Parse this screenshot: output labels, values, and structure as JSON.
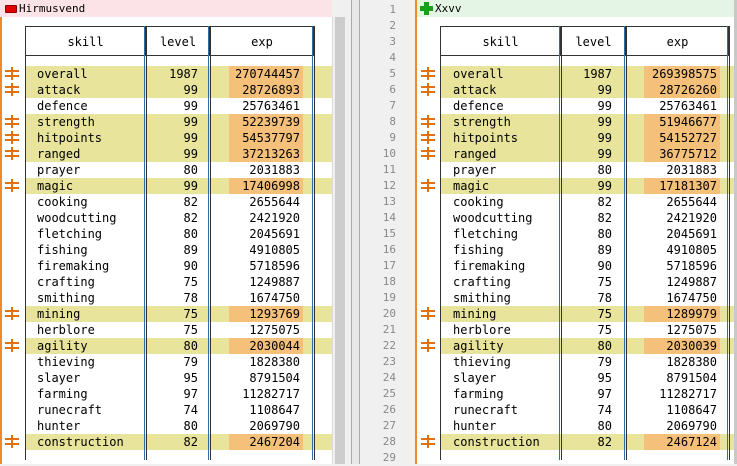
{
  "left_title": "Hirmusvend",
  "right_title": "Xxvv",
  "headers": {
    "skill": "skill",
    "level": "level",
    "exp": "exp"
  },
  "line_numbers": [
    "1",
    "2",
    "3",
    "4",
    "5",
    "6",
    "7",
    "8",
    "9",
    "10",
    "11",
    "12",
    "13",
    "14",
    "15",
    "16",
    "17",
    "18",
    "19",
    "20",
    "21",
    "22",
    "23",
    "24",
    "25",
    "26",
    "27",
    "28",
    "29"
  ],
  "left": [
    {
      "skill": "overall",
      "level": "1987",
      "exp": "270744457",
      "changed": true
    },
    {
      "skill": "attack",
      "level": "99",
      "exp": "28726893",
      "changed": true
    },
    {
      "skill": "defence",
      "level": "99",
      "exp": "25763461",
      "changed": false
    },
    {
      "skill": "strength",
      "level": "99",
      "exp": "52239739",
      "changed": true
    },
    {
      "skill": "hitpoints",
      "level": "99",
      "exp": "54537797",
      "changed": true
    },
    {
      "skill": "ranged",
      "level": "99",
      "exp": "37213263",
      "changed": true
    },
    {
      "skill": "prayer",
      "level": "80",
      "exp": "2031883",
      "changed": false
    },
    {
      "skill": "magic",
      "level": "99",
      "exp": "17406998",
      "changed": true
    },
    {
      "skill": "cooking",
      "level": "82",
      "exp": "2655644",
      "changed": false
    },
    {
      "skill": "woodcutting",
      "level": "82",
      "exp": "2421920",
      "changed": false
    },
    {
      "skill": "fletching",
      "level": "80",
      "exp": "2045691",
      "changed": false
    },
    {
      "skill": "fishing",
      "level": "89",
      "exp": "4910805",
      "changed": false
    },
    {
      "skill": "firemaking",
      "level": "90",
      "exp": "5718596",
      "changed": false
    },
    {
      "skill": "crafting",
      "level": "75",
      "exp": "1249887",
      "changed": false
    },
    {
      "skill": "smithing",
      "level": "78",
      "exp": "1674750",
      "changed": false
    },
    {
      "skill": "mining",
      "level": "75",
      "exp": "1293769",
      "changed": true
    },
    {
      "skill": "herblore",
      "level": "75",
      "exp": "1275075",
      "changed": false
    },
    {
      "skill": "agility",
      "level": "80",
      "exp": "2030044",
      "changed": true
    },
    {
      "skill": "thieving",
      "level": "79",
      "exp": "1828380",
      "changed": false
    },
    {
      "skill": "slayer",
      "level": "95",
      "exp": "8791504",
      "changed": false
    },
    {
      "skill": "farming",
      "level": "97",
      "exp": "11282717",
      "changed": false
    },
    {
      "skill": "runecraft",
      "level": "74",
      "exp": "1108647",
      "changed": false
    },
    {
      "skill": "hunter",
      "level": "80",
      "exp": "2069790",
      "changed": false
    },
    {
      "skill": "construction",
      "level": "82",
      "exp": "2467204",
      "changed": true
    }
  ],
  "right": [
    {
      "skill": "overall",
      "level": "1987",
      "exp": "269398575",
      "changed": true
    },
    {
      "skill": "attack",
      "level": "99",
      "exp": "28726260",
      "changed": true
    },
    {
      "skill": "defence",
      "level": "99",
      "exp": "25763461",
      "changed": false
    },
    {
      "skill": "strength",
      "level": "99",
      "exp": "51946677",
      "changed": true
    },
    {
      "skill": "hitpoints",
      "level": "99",
      "exp": "54152727",
      "changed": true
    },
    {
      "skill": "ranged",
      "level": "99",
      "exp": "36775712",
      "changed": true
    },
    {
      "skill": "prayer",
      "level": "80",
      "exp": "2031883",
      "changed": false
    },
    {
      "skill": "magic",
      "level": "99",
      "exp": "17181307",
      "changed": true
    },
    {
      "skill": "cooking",
      "level": "82",
      "exp": "2655644",
      "changed": false
    },
    {
      "skill": "woodcutting",
      "level": "82",
      "exp": "2421920",
      "changed": false
    },
    {
      "skill": "fletching",
      "level": "80",
      "exp": "2045691",
      "changed": false
    },
    {
      "skill": "fishing",
      "level": "89",
      "exp": "4910805",
      "changed": false
    },
    {
      "skill": "firemaking",
      "level": "90",
      "exp": "5718596",
      "changed": false
    },
    {
      "skill": "crafting",
      "level": "75",
      "exp": "1249887",
      "changed": false
    },
    {
      "skill": "smithing",
      "level": "78",
      "exp": "1674750",
      "changed": false
    },
    {
      "skill": "mining",
      "level": "75",
      "exp": "1289979",
      "changed": true
    },
    {
      "skill": "herblore",
      "level": "75",
      "exp": "1275075",
      "changed": false
    },
    {
      "skill": "agility",
      "level": "80",
      "exp": "2030039",
      "changed": true
    },
    {
      "skill": "thieving",
      "level": "79",
      "exp": "1828380",
      "changed": false
    },
    {
      "skill": "slayer",
      "level": "95",
      "exp": "8791504",
      "changed": false
    },
    {
      "skill": "farming",
      "level": "97",
      "exp": "11282717",
      "changed": false
    },
    {
      "skill": "runecraft",
      "level": "74",
      "exp": "1108647",
      "changed": false
    },
    {
      "skill": "hunter",
      "level": "80",
      "exp": "2069790",
      "changed": false
    },
    {
      "skill": "construction",
      "level": "82",
      "exp": "2467124",
      "changed": true
    }
  ],
  "colors": {
    "changed_row": "#e8e49c",
    "changed_exp": "#f4c07a",
    "diff_marker": "#e07010"
  }
}
